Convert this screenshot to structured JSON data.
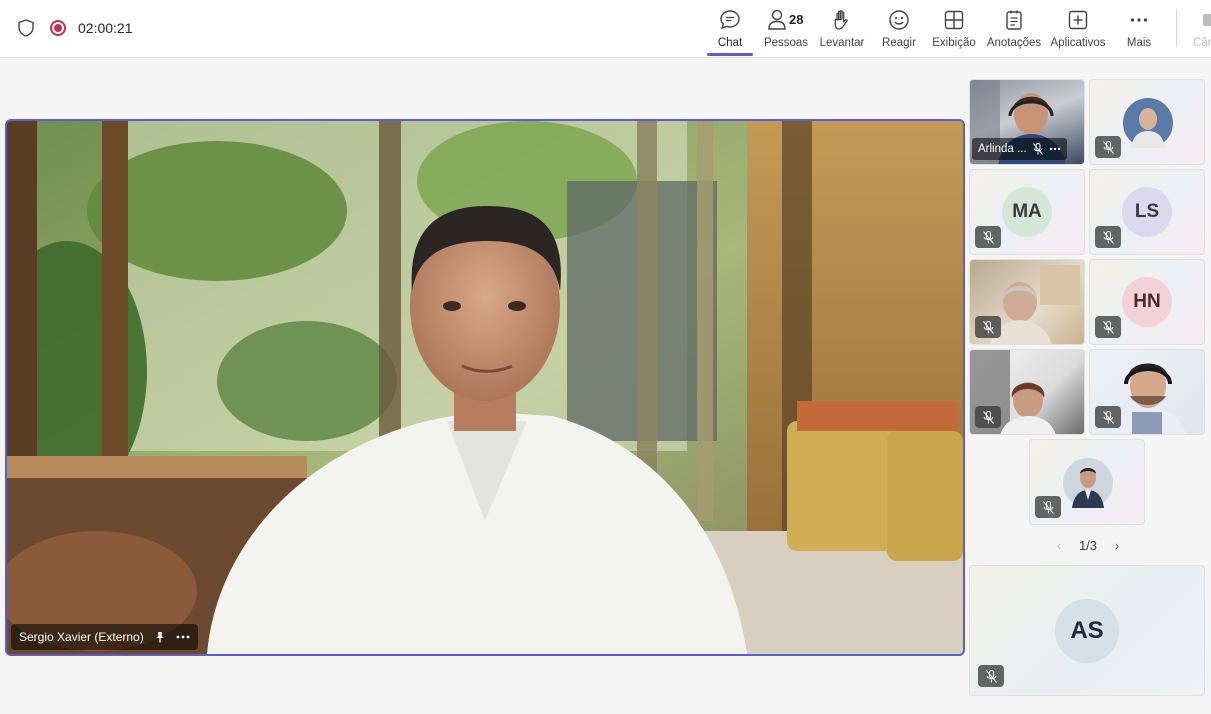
{
  "meeting": {
    "timer": "02:00:21"
  },
  "toolbar": {
    "chat": "Chat",
    "people_count": "28",
    "people": "Pessoas",
    "raise": "Levantar",
    "react": "Reagir",
    "view": "Exibição",
    "notes": "Anotações",
    "apps": "Aplicativos",
    "more": "Mais",
    "camera_partial": "Câm"
  },
  "main_speaker": {
    "name": "Sergio Xavier (Externo)"
  },
  "participants": [
    {
      "name": "Arlinda ...",
      "type": "video",
      "muted": true
    },
    {
      "initials": "",
      "type": "photo",
      "muted": true
    },
    {
      "initials": "MA",
      "type": "initials",
      "muted": true,
      "color": "#d5e6d8"
    },
    {
      "initials": "LS",
      "type": "initials",
      "muted": true,
      "color": "#dcd9ef"
    },
    {
      "type": "video",
      "muted": true
    },
    {
      "initials": "HN",
      "type": "initials",
      "muted": true,
      "color": "#f2d2d8"
    },
    {
      "type": "video",
      "muted": true
    },
    {
      "type": "video",
      "muted": true
    },
    {
      "type": "photo",
      "muted": true
    }
  ],
  "pager": {
    "label": "1/3"
  },
  "big_tile": {
    "initials": "AS"
  },
  "colors": {
    "accent": "#5b5fc7",
    "record": "#c4314b"
  }
}
